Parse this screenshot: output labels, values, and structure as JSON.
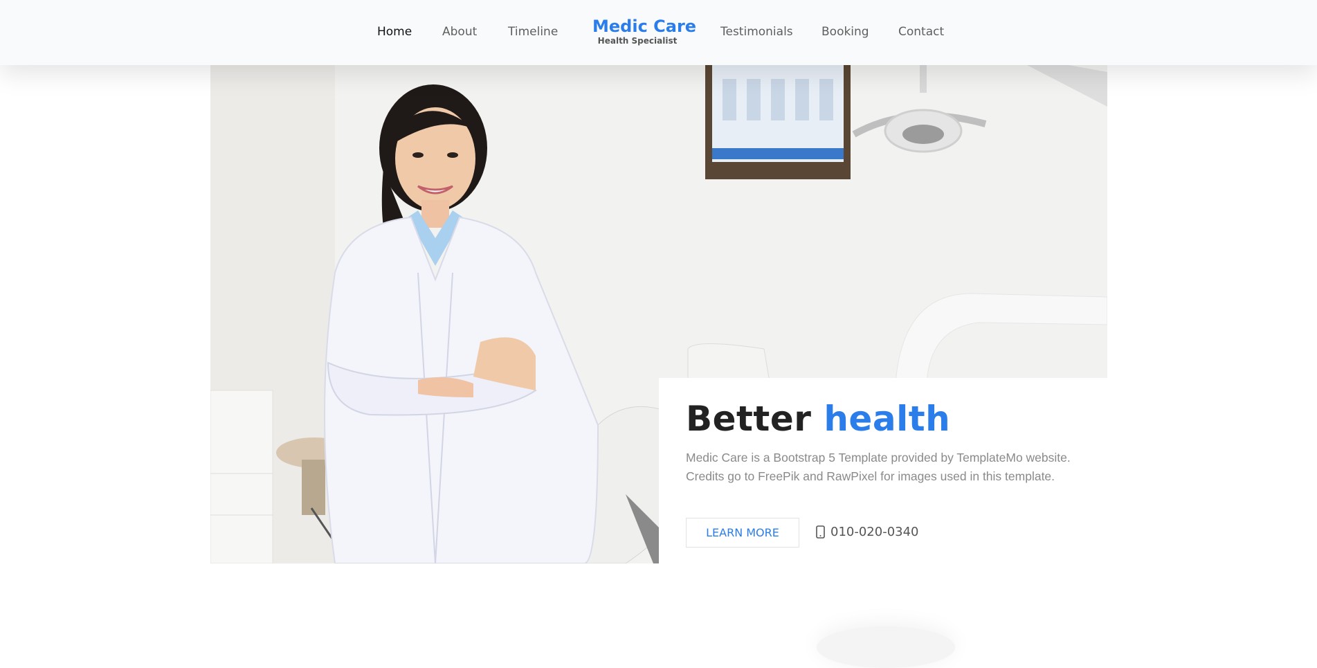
{
  "brand": {
    "name": "Medic Care",
    "tagline": "Health Specialist"
  },
  "nav": {
    "home": "Home",
    "about": "About",
    "timeline": "Timeline",
    "testimonials": "Testimonials",
    "booking": "Booking",
    "contact": "Contact",
    "active": "Home"
  },
  "hero": {
    "title_part1": "Better",
    "title_part2": "health",
    "description": "Medic Care is a Bootstrap 5 Template provided by TemplateMo website. Credits go to FreePik and RawPixel for images used in this template.",
    "button_label": "LEARN MORE",
    "phone": "010-020-0340",
    "phone_icon": "phone-icon",
    "image_subject": "smiling doctor in white coat in dental clinic"
  },
  "colors": {
    "accent": "#2b7de9",
    "navbar_bg": "#f9fafb",
    "heading": "#222222",
    "body_text": "#8a8a8a"
  }
}
